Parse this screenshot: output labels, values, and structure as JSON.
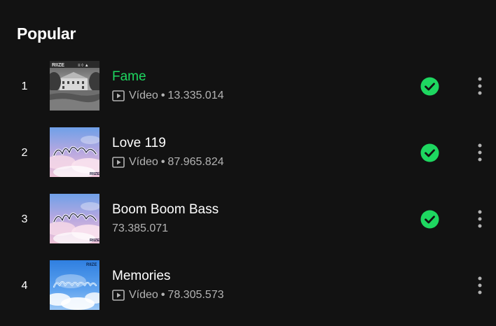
{
  "section": {
    "title": "Popular"
  },
  "colors": {
    "background": "#121212",
    "accent_green": "#1ed760",
    "secondary_text": "#b3b3b3"
  },
  "tracks": [
    {
      "number": "1",
      "title": "Fame",
      "is_playing": true,
      "has_video": true,
      "video_label": "Vídeo",
      "separator": "•",
      "plays": "13.335.014",
      "saved": true,
      "cover_art": "black-white-manor-cover",
      "cover_text": "RIIZE"
    },
    {
      "number": "2",
      "title": "Love 119",
      "is_playing": false,
      "has_video": true,
      "video_label": "Vídeo",
      "separator": "•",
      "plays": "87.965.824",
      "saved": true,
      "cover_art": "pink-sky-cover",
      "cover_text": "RIIZE"
    },
    {
      "number": "3",
      "title": "Boom Boom Bass",
      "is_playing": false,
      "has_video": false,
      "plays": "73.385.071",
      "saved": true,
      "cover_art": "pink-sky-cover",
      "cover_text": "RIIZE"
    },
    {
      "number": "4",
      "title": "Memories",
      "is_playing": false,
      "has_video": true,
      "video_label": "Vídeo",
      "separator": "•",
      "plays": "78.305.573",
      "saved": false,
      "cover_art": "blue-sky-cover",
      "cover_text": "RIIZE"
    }
  ]
}
